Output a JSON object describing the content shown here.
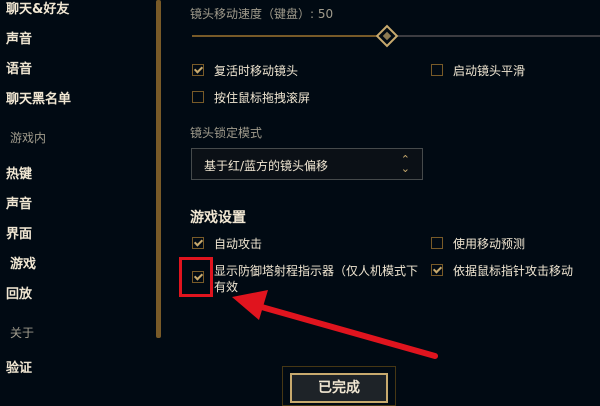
{
  "sidebar": {
    "items": [
      {
        "label": "聊天&好友"
      },
      {
        "label": "声音"
      },
      {
        "label": "语音"
      },
      {
        "label": "聊天黑名单"
      },
      {
        "label": "游戏内"
      },
      {
        "label": "热键"
      },
      {
        "label": "声音"
      },
      {
        "label": "界面"
      },
      {
        "label": "游戏"
      },
      {
        "label": "回放"
      },
      {
        "label": "关于"
      },
      {
        "label": "验证"
      }
    ]
  },
  "camera": {
    "speed_label": "镜头移动速度（键盘）: 50",
    "speed_value": 50,
    "options": [
      {
        "label": "复活时移动镜头",
        "checked": true
      },
      {
        "label": "启动镜头平滑",
        "checked": false
      },
      {
        "label": "按住鼠标拖拽滚屏",
        "checked": false
      }
    ],
    "lock_mode_label": "镜头锁定模式",
    "lock_mode_value": "基于红/蓝方的镜头偏移"
  },
  "game_settings": {
    "title": "游戏设置",
    "options": [
      {
        "label": "自动攻击",
        "checked": true
      },
      {
        "label": "使用移动预测",
        "checked": false
      },
      {
        "label": "显示防御塔射程指示器（仅人机模式下",
        "label_line2": "有效",
        "checked": true
      },
      {
        "label": "依据鼠标指针攻击移动",
        "checked": true
      }
    ]
  },
  "footer": {
    "done_label": "已完成"
  },
  "colors": {
    "background": "#010a13",
    "gold": "#c8aa6e",
    "text_light": "#f0e6d2",
    "text_muted": "#a09b8c",
    "annotation_red": "#e0141e"
  }
}
